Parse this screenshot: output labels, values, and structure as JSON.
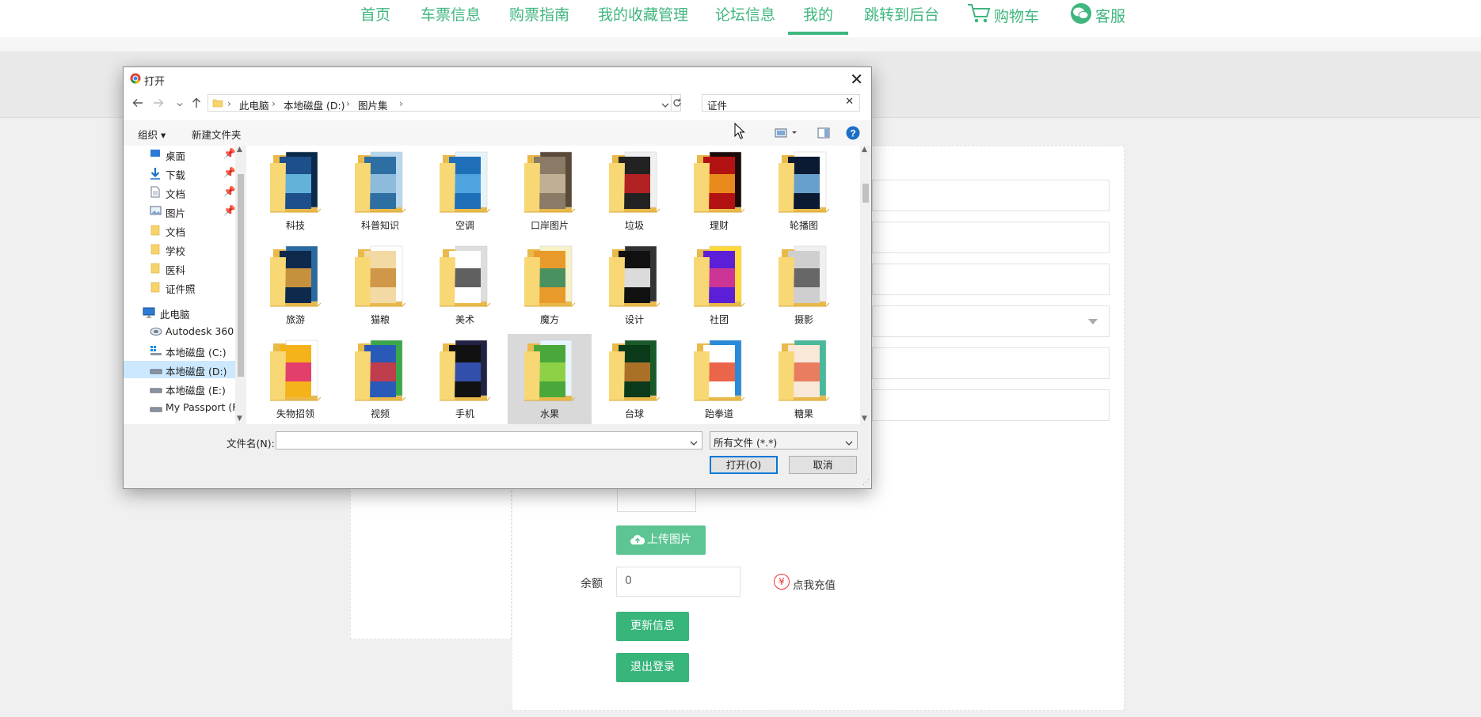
{
  "topnav": {
    "items": [
      {
        "label": "首页"
      },
      {
        "label": "车票信息"
      },
      {
        "label": "购票指南"
      },
      {
        "label": "我的收藏管理"
      },
      {
        "label": "论坛信息"
      },
      {
        "label": "我的"
      },
      {
        "label": "跳转到后台"
      },
      {
        "label": "购物车"
      },
      {
        "label": "客服"
      }
    ],
    "accent_color": "#3fb67e"
  },
  "profile": {
    "upload_button": "上传图片",
    "balance_label": "余额",
    "balance_value": "0",
    "recharge_link": "点我充值",
    "update_button": "更新信息",
    "logout_button": "退出登录"
  },
  "dialog": {
    "title": "打开",
    "close_glyph": "✕",
    "breadcrumb": [
      "此电脑",
      "本地磁盘 (D:)",
      "图片集"
    ],
    "search_value": "证件",
    "toolbar": {
      "organize": "组织",
      "new_folder": "新建文件夹"
    },
    "tree": [
      {
        "label": "桌面",
        "icon": "desktop-icon",
        "pinned": true
      },
      {
        "label": "下载",
        "icon": "download-icon",
        "pinned": true
      },
      {
        "label": "文档",
        "icon": "document-icon",
        "pinned": true
      },
      {
        "label": "图片",
        "icon": "picture-icon",
        "pinned": true
      },
      {
        "label": "文档",
        "icon": "folder-icon",
        "pinned": false
      },
      {
        "label": "学校",
        "icon": "folder-icon",
        "pinned": false
      },
      {
        "label": "医科",
        "icon": "folder-icon",
        "pinned": false
      },
      {
        "label": "证件照",
        "icon": "folder-icon",
        "pinned": false
      },
      {
        "label": "此电脑",
        "icon": "computer-icon",
        "pinned": false
      },
      {
        "label": "Autodesk 360",
        "icon": "cloud-drive-icon",
        "pinned": false
      },
      {
        "label": "本地磁盘 (C:)",
        "icon": "windows-drive-icon",
        "pinned": false
      },
      {
        "label": "本地磁盘 (D:)",
        "icon": "drive-icon",
        "pinned": false,
        "selected": true
      },
      {
        "label": "本地磁盘 (E:)",
        "icon": "drive-icon",
        "pinned": false
      },
      {
        "label": "My Passport (F",
        "icon": "drive-icon",
        "pinned": false
      }
    ],
    "folders": [
      {
        "name": "科技",
        "colors": [
          "#1d4f8a",
          "#6fc3e8",
          "#0a2a4a"
        ]
      },
      {
        "name": "科普知识",
        "colors": [
          "#2e6fa3",
          "#9dc9e6",
          "#b8d7ee"
        ]
      },
      {
        "name": "空调",
        "colors": [
          "#1f6fb8",
          "#58aee6",
          "#e7f3fb"
        ]
      },
      {
        "name": "口岸图片",
        "colors": [
          "#8a7a66",
          "#c9b89a",
          "#5a4a3a"
        ]
      },
      {
        "name": "垃圾",
        "colors": [
          "#222222",
          "#cc2222",
          "#f0f0f0"
        ]
      },
      {
        "name": "理财",
        "colors": [
          "#b31212",
          "#f2a01e",
          "#1a0a0a"
        ]
      },
      {
        "name": "轮播图",
        "colors": [
          "#0a1a33",
          "#7ab8e6",
          "#ffffff"
        ]
      },
      {
        "name": "旅游",
        "colors": [
          "#0d2a4d",
          "#e8a33a",
          "#2a6aa0"
        ]
      },
      {
        "name": "猫粮",
        "colors": [
          "#f3d9a4",
          "#c98b3a",
          "#ffffff"
        ]
      },
      {
        "name": "美术",
        "colors": [
          "#ffffff",
          "#444444",
          "#dddddd"
        ]
      },
      {
        "name": "魔方",
        "colors": [
          "#e89a2a",
          "#2f8f6a",
          "#f7f1c8"
        ]
      },
      {
        "name": "设计",
        "colors": [
          "#111111",
          "#ffffff",
          "#333333"
        ]
      },
      {
        "name": "社团",
        "colors": [
          "#5a1fd6",
          "#e03a8a",
          "#ffd83a"
        ]
      },
      {
        "name": "摄影",
        "colors": [
          "#cfcfcf",
          "#555555",
          "#f0f0f0"
        ]
      },
      {
        "name": "失物招领",
        "colors": [
          "#f4b31a",
          "#e02a7a",
          "#ffffff"
        ]
      },
      {
        "name": "视频",
        "colors": [
          "#2a5ab8",
          "#d83a3a",
          "#3aa84a"
        ]
      },
      {
        "name": "手机",
        "colors": [
          "#111111",
          "#3a5ac8",
          "#222244"
        ]
      },
      {
        "name": "水果",
        "colors": [
          "#4aa83a",
          "#9ad84a",
          "#e8f4ff"
        ]
      },
      {
        "name": "台球",
        "colors": [
          "#0a3a1a",
          "#c87a2a",
          "#1a5a2a"
        ]
      },
      {
        "name": "跆拳道",
        "colors": [
          "#ffffff",
          "#e84a2a",
          "#2a8ad8"
        ]
      },
      {
        "name": "糖果",
        "colors": [
          "#f7e8d8",
          "#e86a4a",
          "#4ab89a"
        ]
      }
    ],
    "filename_label": "文件名(N):",
    "filename_value": "",
    "filetype_value": "所有文件 (*.*)",
    "open_button": "打开(O)",
    "cancel_button": "取消"
  }
}
